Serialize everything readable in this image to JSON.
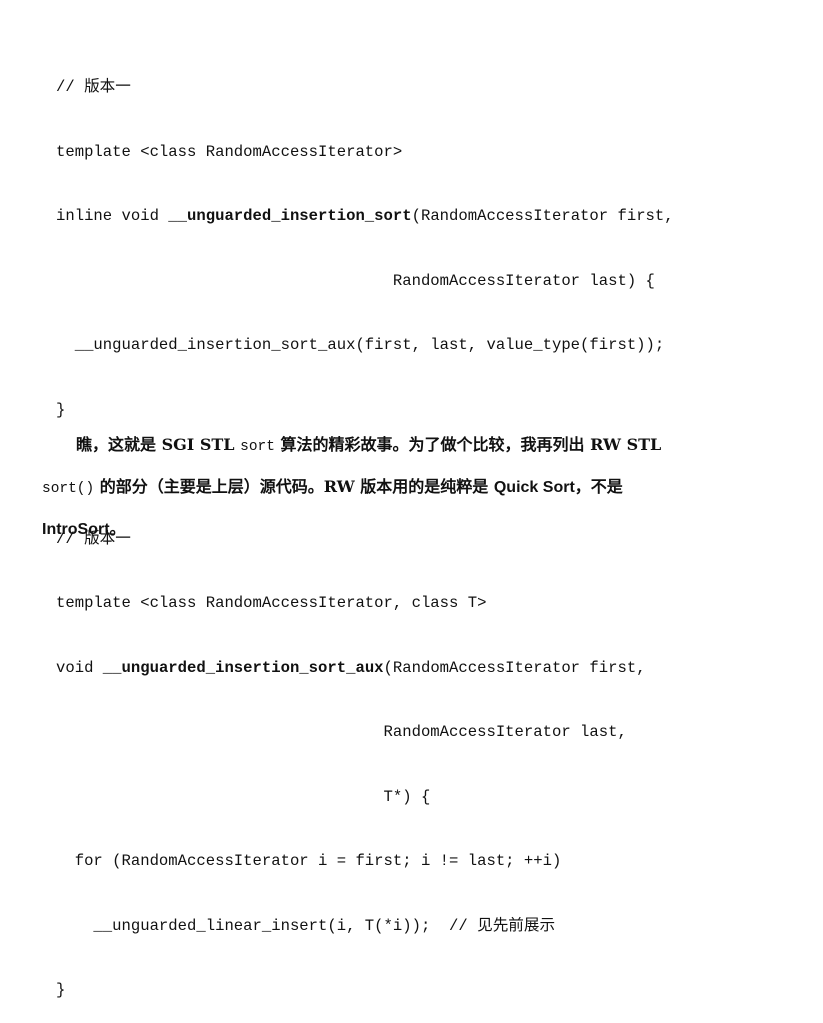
{
  "code": {
    "block1": {
      "comment": "// 版本一",
      "l2": "template <class RandomAccessIterator>",
      "l3_pre": "inline void ",
      "l3_fn": "__unguarded_insertion_sort",
      "l3_post": "(RandomAccessIterator first,",
      "l4": "                                    RandomAccessIterator last) {",
      "l5": "  __unguarded_insertion_sort_aux(first, last, value_type(first));",
      "l6": "}"
    },
    "block2": {
      "comment": "// 版本一",
      "l2": "template <class RandomAccessIterator, class T>",
      "l3_pre": "void ",
      "l3_fn": "__unguarded_insertion_sort_aux",
      "l3_post": "(RandomAccessIterator first,",
      "l4": "                                   RandomAccessIterator last,",
      "l5": "                                   T*) {",
      "l6": "  for (RandomAccessIterator i = first; i != last; ++i)",
      "l7": "    __unguarded_linear_insert(i, T(*i));  // 见先前展示",
      "l8": "}"
    }
  },
  "prose": {
    "p1_a": "瞧，这就是 SGI STL ",
    "p1_code": "sort",
    "p1_b": " 算法的精彩故事。为了做个比较，我再列出 RW STL",
    "p2_code": "sort()",
    "p2_a": " 的部分（主要是上层）源代码。RW 版本用的是纯粹是 ",
    "p2_qs": "Quick Sort",
    "p2_b": "，不是",
    "p3_intro": "IntroSort",
    "p3_end": "。"
  }
}
